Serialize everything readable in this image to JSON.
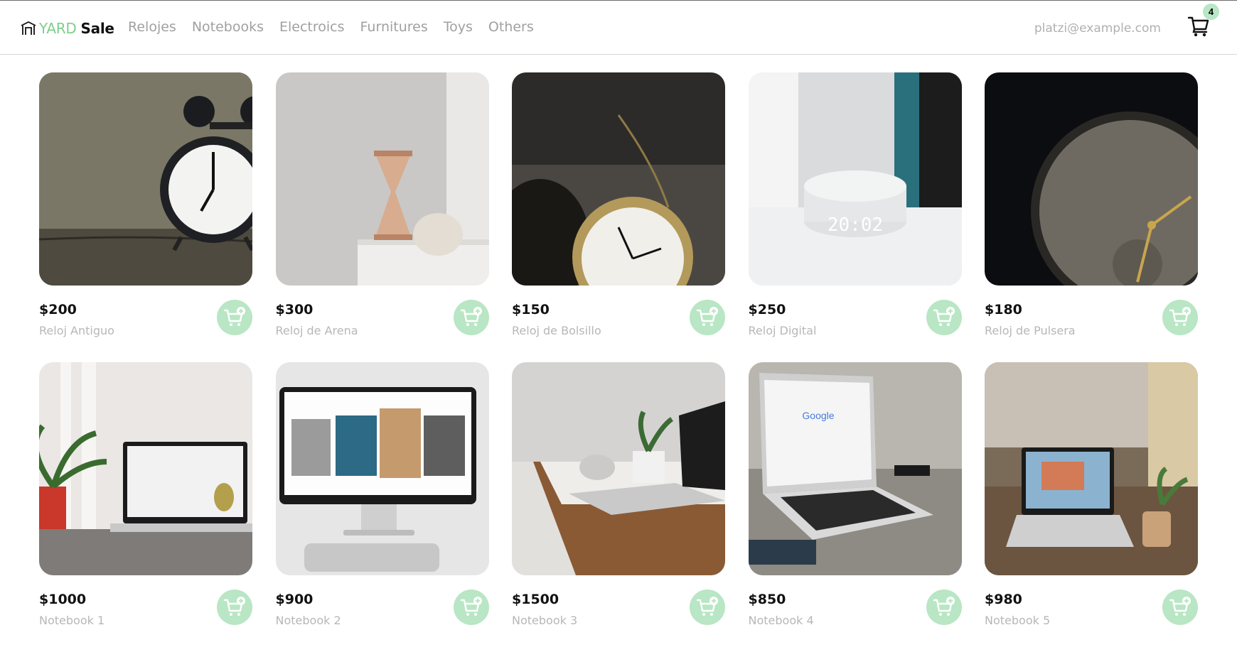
{
  "brand": {
    "yard": "YARD",
    "sale": "Sale"
  },
  "nav": [
    {
      "label": "Relojes"
    },
    {
      "label": "Notebooks"
    },
    {
      "label": "Electroics"
    },
    {
      "label": "Furnitures"
    },
    {
      "label": "Toys"
    },
    {
      "label": "Others"
    }
  ],
  "user": {
    "email": "platzi@example.com"
  },
  "cart": {
    "count": "4",
    "icon": "shopping-cart-icon"
  },
  "colors": {
    "accent": "#b9e6c4",
    "brand_green": "#7dcf8a",
    "muted_text": "#a0a0a0"
  },
  "products": [
    {
      "price": "$200",
      "name": "Reloj Antiguo",
      "image": "alarm-clock-photo"
    },
    {
      "price": "$300",
      "name": "Reloj de Arena",
      "image": "hourglass-photo"
    },
    {
      "price": "$150",
      "name": "Reloj de Bolsillo",
      "image": "pocket-watch-photo"
    },
    {
      "price": "$250",
      "name": "Reloj Digital",
      "image": "smart-speaker-clock-photo"
    },
    {
      "price": "$180",
      "name": "Reloj de Pulsera",
      "image": "wristwatch-face-photo"
    },
    {
      "price": "$1000",
      "name": "Notebook 1",
      "image": "laptop-with-plant-photo"
    },
    {
      "price": "$900",
      "name": "Notebook 2",
      "image": "desktop-monitor-photo"
    },
    {
      "price": "$1500",
      "name": "Notebook 3",
      "image": "laptop-on-desk-photo"
    },
    {
      "price": "$850",
      "name": "Notebook 4",
      "image": "laptop-google-photo"
    },
    {
      "price": "$980",
      "name": "Notebook 5",
      "image": "laptop-cafe-photo"
    }
  ]
}
